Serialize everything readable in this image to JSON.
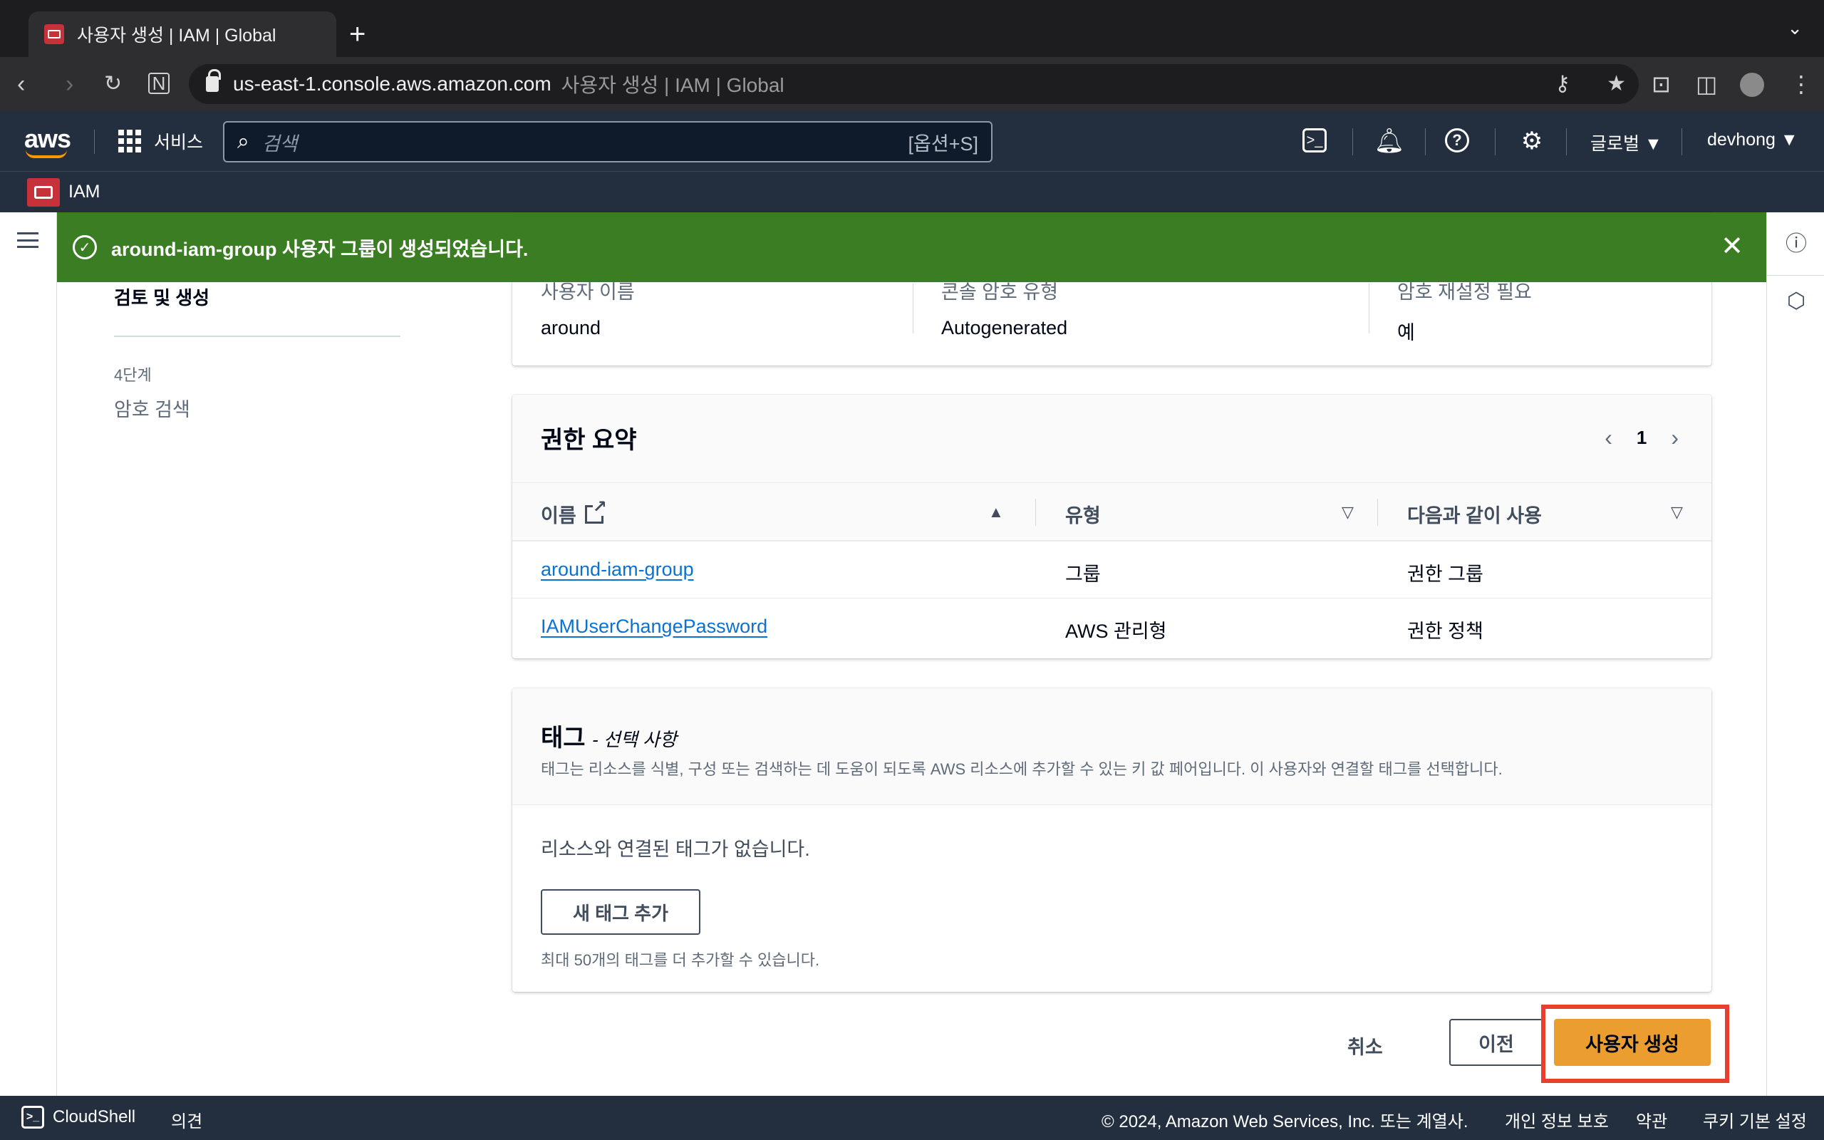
{
  "browser": {
    "tab_title": "사용자 생성 | IAM | Global",
    "new_tab": "+",
    "url_host": "us-east-1.console.aws.amazon.com",
    "url_page_title": "사용자 생성 | IAM | Global"
  },
  "aws_nav": {
    "logo": "aws",
    "services_label": "서비스",
    "search_placeholder": "검색",
    "search_shortcut": "[옵션+S]",
    "region_label": "글로벌 ▼",
    "account_label": "devhong ▼",
    "service_name": "IAM"
  },
  "flash": {
    "message": "around-iam-group 사용자 그룹이 생성되었습니다.",
    "status_color": "#3b7d23"
  },
  "steps": {
    "current_step": "검토 및 생성",
    "next_step_number": "4단계",
    "next_step_name": "암호 검색"
  },
  "user_details": {
    "columns": [
      {
        "label": "사용자 이름",
        "value": "around"
      },
      {
        "label": "콘솔 암호 유형",
        "value": "Autogenerated"
      },
      {
        "label": "암호 재설정 필요",
        "value": "예"
      }
    ]
  },
  "permissions": {
    "title": "권한 요약",
    "page": "1",
    "headers": {
      "name": "이름",
      "type": "유형",
      "used_as": "다음과 같이 사용"
    },
    "rows": [
      {
        "name": "around-iam-group",
        "type": "그룹",
        "used_as": "권한 그룹"
      },
      {
        "name": "IAMUserChangePassword",
        "type": "AWS 관리형",
        "used_as": "권한 정책"
      }
    ]
  },
  "tags": {
    "title": "태그",
    "optional": "- 선택 사항",
    "description": "태그는 리소스를 식별, 구성 또는 검색하는 데 도움이 되도록 AWS 리소스에 추가할 수 있는 키 값 페어입니다. 이 사용자와 연결할 태그를 선택합니다.",
    "empty_message": "리소스와 연결된 태그가 없습니다.",
    "add_button": "새 태그 추가",
    "limit_hint": "최대 50개의 태그를 더 추가할 수 있습니다."
  },
  "actions": {
    "cancel": "취소",
    "previous": "이전",
    "create": "사용자 생성",
    "primary_color": "#ec9d2f",
    "highlight_color": "#e8402c"
  },
  "footer": {
    "cloudshell": "CloudShell",
    "feedback": "의견",
    "copyright": "© 2024, Amazon Web Services, Inc. 또는 계열사.",
    "privacy": "개인 정보 보호",
    "terms": "약관",
    "cookies": "쿠키 기본 설정"
  }
}
